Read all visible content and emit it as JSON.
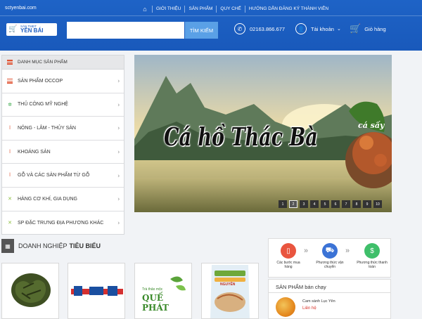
{
  "header": {
    "site_url": "sctyenbai.com",
    "nav": [
      "GIỚI THIỆU",
      "SẢN PHẨM",
      "QUY CHẾ",
      "HƯỚNG DẪN ĐĂNG KÝ THÀNH VIÊN"
    ],
    "logo_small": "SÀN TMĐT",
    "logo_big": "YÊN BÁI",
    "search_placeholder": "",
    "search_button": "TÌM KIẾM",
    "hotline": "02163.866.677",
    "account": "Tài khoản",
    "cart": "Giỏ hàng",
    "brand_color": "#1e63c6"
  },
  "sidebar": {
    "title": "DANH MỤC SẢN PHẨM",
    "items": [
      {
        "label": "SẢN PHẨM OCCOP",
        "icon": "bars-icon"
      },
      {
        "label": "THỦ CÔNG MỸ NGHỆ",
        "icon": "craft-icon"
      },
      {
        "label": "NÔNG - LÂM - THỦY SẢN",
        "icon": "bottle-icon"
      },
      {
        "label": "KHOÁNG SẢN",
        "icon": "bottle-icon"
      },
      {
        "label": "GỖ VÀ CÁC SẢN PHẨM TỪ GỖ",
        "icon": "bottle-icon"
      },
      {
        "label": "HÀNG CƠ KHÍ, GIA DỤNG",
        "icon": "tools-icon"
      },
      {
        "label": "SP ĐẶC TRƯNG ĐỊA PHƯƠNG KHÁC",
        "icon": "tools-icon"
      }
    ]
  },
  "banner": {
    "title": "Cá hồ Thác Bà",
    "dish_label": "cá sấy",
    "pages": [
      "1",
      "2",
      "3",
      "4",
      "5",
      "6",
      "7",
      "8",
      "9",
      "10"
    ],
    "active_page": "2"
  },
  "section": {
    "prefix": "DOANH NGHIỆP",
    "highlight": "TIÊU BIỂU"
  },
  "products": {
    "que_phat_top": "Trà thảo mộc",
    "que_phat": "QUẾ PHÁT",
    "bag_text": "NGUYÊN"
  },
  "steps": [
    {
      "label": "Các bước mua hàng",
      "color": "#e9553f"
    },
    {
      "label": "Phương thức vận chuyển",
      "color": "#3b73d6"
    },
    {
      "label": "Phương thức thanh toán",
      "color": "#3fbf6a"
    }
  ],
  "best_selling": {
    "title": "SẢN PHẨM bán chạy",
    "item_name": "Cam sành Lục Yên",
    "item_price": "Liên hệ"
  }
}
